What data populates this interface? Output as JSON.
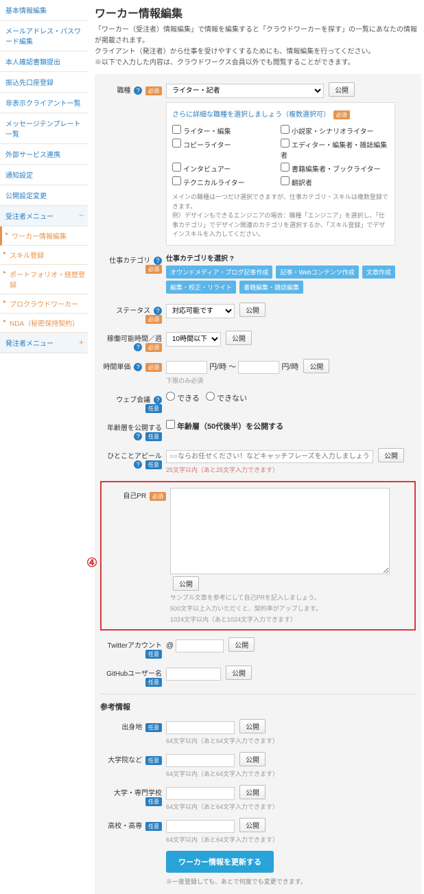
{
  "sidebar": {
    "items": [
      "基本情報編集",
      "メールアドレス・パスワード編集",
      "本人確認書類提出",
      "振込先口座登録",
      "非表示クライアント一覧",
      "メッセージテンプレート一覧",
      "外部サービス連携",
      "通知設定",
      "公開設定変更"
    ],
    "worker_menu": {
      "title": "受注者メニュー",
      "items": [
        "ワーカー情報編集",
        "スキル登録",
        "ポートフォリオ・経歴登録",
        "プロクラウドワーカー",
        "NDA（秘密保持契約）"
      ]
    },
    "client_menu": {
      "title": "発注者メニュー"
    }
  },
  "page": {
    "title": "ワーカー情報編集",
    "desc1": "「ワーカー（受注者）情報編集」で情報を編集すると「クラウドワーカーを探す」の一覧にあなたの情報が掲載されます。",
    "desc2": "クライアント（発注者）から仕事を受けやすくするためにも、情報編集を行ってください。",
    "desc3": "※以下で入力した内容は、クラウドワークス会員以外でも閲覧することができます。"
  },
  "labels": {
    "job_type": "職種",
    "job_category": "仕事カテゴリ",
    "status": "ステータス",
    "hours": "稼働可能時間／週",
    "rate": "時間単価",
    "web_meeting": "ウェブ会議",
    "age": "年齢層を公開する",
    "appeal": "ひとことアピール",
    "pr": "自己PR",
    "twitter": "Twitterアカウント",
    "github": "GitHubユーザー名",
    "required": "必須",
    "optional": "任意",
    "help": "?",
    "publish": "公開"
  },
  "job_type": {
    "selected": "ライター・記者",
    "detail_title": "さらに詳細な職種を選択しましょう（複数選択可）",
    "options": [
      "ライター・編集",
      "小説家・シナリオライター",
      "コピーライター",
      "エディター・編集者・雑誌編集者",
      "インタビュアー",
      "書籍編集者・ブックライター",
      "テクニカルライター",
      "翻訳者"
    ],
    "note": "メインの職種は一つだけ選択できますが、仕事カテゴリ・スキルは複数登録できます。\n例）デザインもできるエンジニアの場合：職種「エンジニア」を選択し、「仕事カテゴリ」でデザイン関連のカテゴリを選択するか、「スキル登録」でデザインスキルを入力してください。"
  },
  "category": {
    "title": "仕事カテゴリを選択",
    "tags": [
      "オウンドメディア・ブログ記事作成",
      "記事・Webコンテンツ作成",
      "文章作成",
      "編集・校正・リライト",
      "書籍編集・雑誌編集"
    ]
  },
  "status": {
    "selected": "対応可能です"
  },
  "hours": {
    "selected": "10時間以下"
  },
  "rate": {
    "unit1": "円/時 ～",
    "unit2": "円/時",
    "note": "下限のみ必須"
  },
  "web_meeting": {
    "opt1": "できる",
    "opt2": "できない"
  },
  "age": {
    "text": "年齢層（50代後半）を公開する"
  },
  "appeal": {
    "placeholder": "○○ならお任せください！などキャッチフレーズを入力しましょう",
    "note": "25文字以内（あと25文字入力できます）"
  },
  "pr": {
    "note1": "サンプル文章を参考にして自己PRを記入しましょう。",
    "note2": "500文字以上入力いただくと、契約率がアップします。",
    "note3": "1024文字以内（あと1024文字入力できます）"
  },
  "twitter": {
    "prefix": "@"
  },
  "ref": {
    "title": "参考情報",
    "birthplace": "出身地",
    "grad": "大学院など",
    "univ": "大学・専門学校",
    "high": "高校・高専",
    "note": "64文字以内（あと64文字入力できます）"
  },
  "submit": {
    "button": "ワーカー情報を更新する",
    "note": "※一度登録しても、あとで何度でも変更できます。"
  },
  "annotation": "④"
}
